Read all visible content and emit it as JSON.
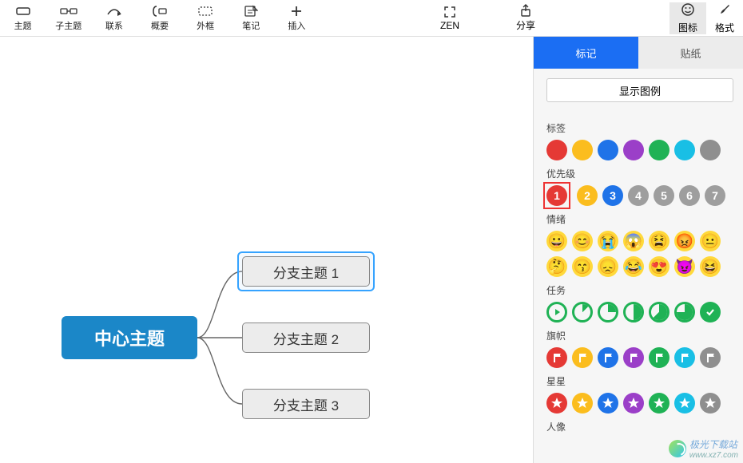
{
  "toolbar": {
    "items": [
      {
        "label": "主题",
        "icon": "topic"
      },
      {
        "label": "子主题",
        "icon": "subtopic"
      },
      {
        "label": "联系",
        "icon": "relation"
      },
      {
        "label": "概要",
        "icon": "summary"
      },
      {
        "label": "外框",
        "icon": "boundary"
      },
      {
        "label": "笔记",
        "icon": "notes"
      },
      {
        "label": "插入",
        "icon": "insert"
      }
    ],
    "zen": {
      "label": "ZEN",
      "icon": "expand"
    },
    "share": {
      "label": "分享",
      "icon": "share"
    },
    "panel_tabs": {
      "icon_label": "图标",
      "format_label": "格式"
    }
  },
  "side": {
    "tab_markers": "标记",
    "tab_stickers": "贴纸",
    "show_legend": "显示图例",
    "section_tag": "标签",
    "section_priority": "优先级",
    "section_mood": "情绪",
    "section_task": "任务",
    "section_flag": "旗帜",
    "section_star": "星星",
    "section_person": "人像",
    "priority_values": [
      "1",
      "2",
      "3",
      "4",
      "5",
      "6",
      "7"
    ],
    "tag_colors": [
      "#e53935",
      "#fbbd1e",
      "#1f73e8",
      "#9b3fc8",
      "#1fb255",
      "#19bfe5",
      "#8f8f8f"
    ],
    "flag_colors": [
      "#e53935",
      "#fbbd1e",
      "#1f73e8",
      "#9b3fc8",
      "#1fb255",
      "#19bfe5",
      "#8f8f8f"
    ],
    "star_colors": [
      "#e53935",
      "#fbbd1e",
      "#1f73e8",
      "#9b3fc8",
      "#1fb255",
      "#19bfe5",
      "#8f8f8f"
    ],
    "priority_colors": [
      "#e53935",
      "#fbbd1e",
      "#1f73e8",
      "#9e9e9e",
      "#9e9e9e",
      "#9e9e9e",
      "#9e9e9e"
    ],
    "mood_row1": [
      "😀",
      "😊",
      "😭",
      "😱",
      "😫",
      "😡",
      "😐"
    ],
    "mood_row2": [
      "🤔",
      "😙",
      "😞",
      "😂",
      "😍",
      "😈",
      "😆"
    ]
  },
  "mindmap": {
    "center": "中心主题",
    "b1": "分支主题 1",
    "b2": "分支主题 2",
    "b3": "分支主题 3"
  },
  "watermark": "极光下载站",
  "watermark_url": "www.xz7.com"
}
